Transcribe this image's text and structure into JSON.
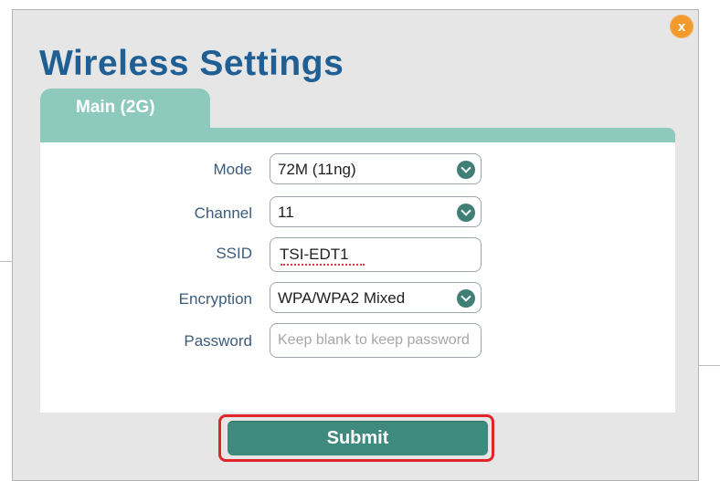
{
  "dialog": {
    "title": "Wireless Settings",
    "close_label": "x"
  },
  "tabs": [
    {
      "label": "Main (2G)",
      "active": true
    }
  ],
  "form": {
    "mode": {
      "label": "Mode",
      "value": "72M (11ng)"
    },
    "channel": {
      "label": "Channel",
      "value": "11"
    },
    "ssid": {
      "label": "SSID",
      "value": "TSI-EDT1"
    },
    "encryption": {
      "label": "Encryption",
      "value": "WPA/WPA2 Mixed"
    },
    "password": {
      "label": "Password",
      "value": "",
      "placeholder": "Keep blank to keep password"
    }
  },
  "actions": {
    "submit_label": "Submit"
  },
  "colors": {
    "title": "#1f5f94",
    "tab": "#8ec9bd",
    "button": "#3f8a7f",
    "close": "#f39a2d",
    "highlight": "#e0262b"
  }
}
